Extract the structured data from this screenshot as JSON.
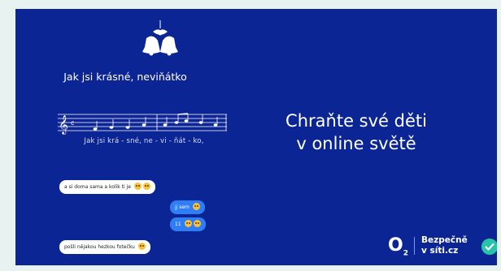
{
  "song": {
    "title": "Jak jsi krásné, neviňátko",
    "lyrics": "Jak  jsi  krá - sné,  ne - vi - ňát - ko,"
  },
  "chat": [
    {
      "side": "in",
      "text": "a si doma sama a kolik ti je",
      "emoji": [
        "smile-emoji",
        "smile-emoji"
      ]
    },
    {
      "side": "out",
      "text": "jj sem",
      "emoji": [
        "grin-emoji"
      ]
    },
    {
      "side": "out",
      "text": "11",
      "emoji": [
        "grin-emoji",
        "grin-emoji"
      ]
    },
    {
      "side": "in",
      "text": "pošli nějakou hezkou fotečku",
      "emoji": [
        "smile-emoji"
      ]
    }
  ],
  "headline": {
    "line1": "Chraňte své děti",
    "line2": "v online světě"
  },
  "logo": {
    "o2": "O",
    "o2_sub": "2",
    "brand_line1": "Bezpečně",
    "brand_line2": "v síti.cz"
  },
  "colors": {
    "background": "#0c2594",
    "page": "#e8f3f1",
    "bubble_out": "#2f7ef8",
    "check": "#27c3a8"
  }
}
